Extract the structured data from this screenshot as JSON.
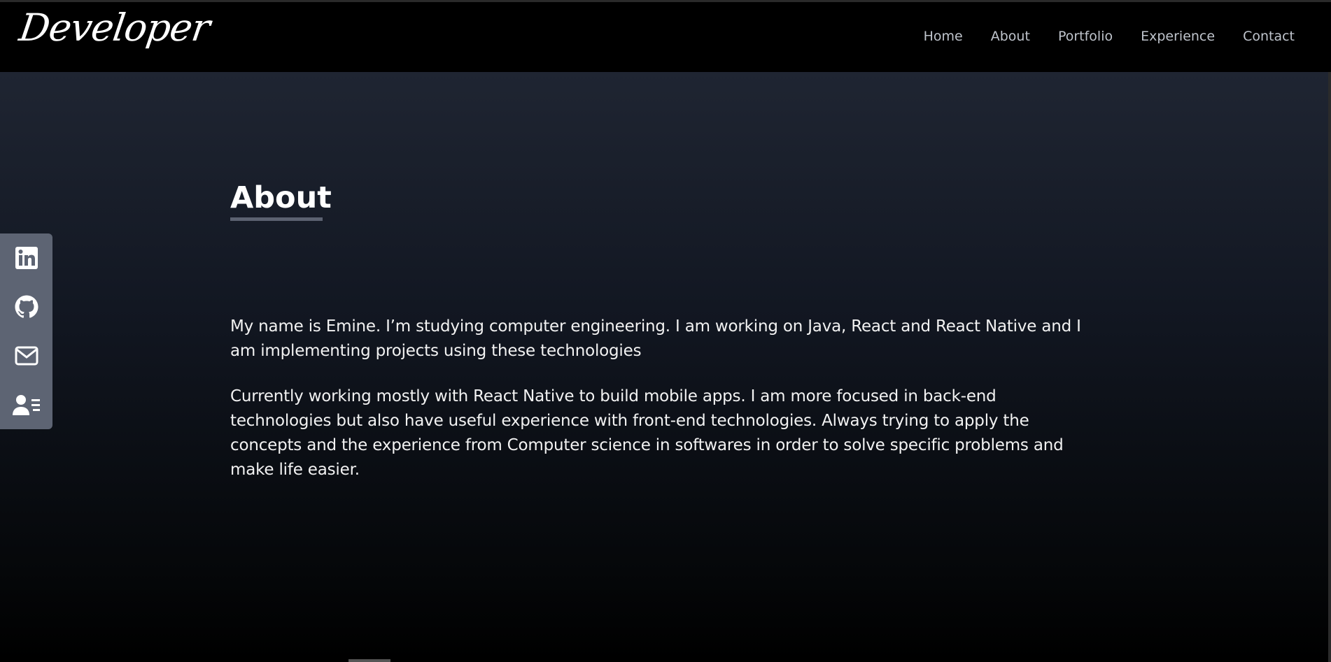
{
  "header": {
    "logo": "Developer",
    "nav": [
      "Home",
      "About",
      "Portfolio",
      "Experience",
      "Contact"
    ]
  },
  "about": {
    "title": "About",
    "paragraphs": [
      "My name is Emine. I’m studying computer engineering. I am working on Java, React and React Native and I am implementing projects using these technologies",
      "Currently working mostly with React Native to build mobile apps. I am more focused in back-end technologies but also have useful experience with front-end technologies. Always trying to apply the concepts and the experience from Computer science in softwares in order to solve specific problems and make life easier."
    ]
  },
  "social": {
    "icons": [
      "linkedin-icon",
      "github-icon",
      "mail-icon",
      "resume-icon"
    ]
  },
  "colors": {
    "nav_text": "#bfc4cc",
    "sidebar_bg": "#5d6473",
    "underline": "#5c6271"
  }
}
